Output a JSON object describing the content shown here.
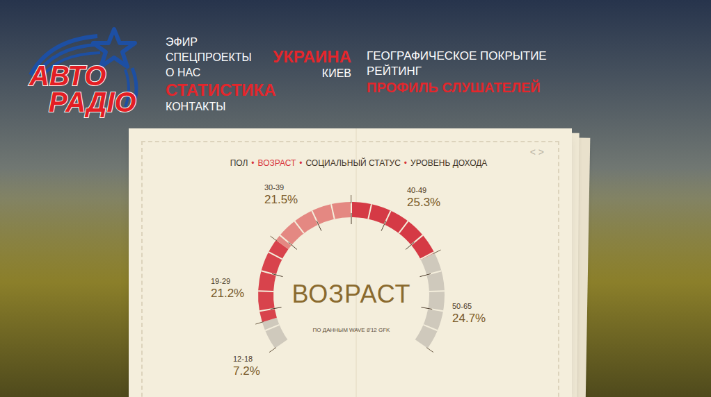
{
  "logo": {
    "line1": "АВТО",
    "line2": "РАДІО"
  },
  "nav": {
    "items": [
      {
        "label": "ЭФИР",
        "selected": false
      },
      {
        "label": "СПЕЦПРОЕКТЫ",
        "selected": false
      },
      {
        "label": "О НАС",
        "selected": false
      },
      {
        "label": "СТАТИСТИКА",
        "selected": true
      },
      {
        "label": "КОНТАКТЫ",
        "selected": false
      }
    ]
  },
  "region": {
    "items": [
      {
        "label": "УКРАИНА",
        "selected": true
      },
      {
        "label": "КИЕВ",
        "selected": false
      }
    ]
  },
  "submenu": {
    "items": [
      {
        "label": "ГЕОГРАФИЧЕСКОЕ ПОКРЫТИЕ",
        "selected": false
      },
      {
        "label": "РЕЙТИНГ",
        "selected": false
      },
      {
        "label": "ПРОФИЛЬ СЛУШАТЕЛЕЙ",
        "selected": true
      }
    ]
  },
  "panel": {
    "tabs": [
      {
        "label": "ПОЛ",
        "selected": false
      },
      {
        "label": "ВОЗРАСТ",
        "selected": true
      },
      {
        "label": "СОЦИАЛЬНЫЙ СТАТУС",
        "selected": false
      },
      {
        "label": "УРОВЕНЬ ДОХОДА",
        "selected": false
      }
    ],
    "separator": "•",
    "arrows": [
      "<",
      ">"
    ],
    "gauge": {
      "title": "ВОЗРАСТ",
      "source": "ПО ДАННЫМ WAVE 8'12 GFK",
      "segments": [
        {
          "label": "12-18",
          "value": "7.2%",
          "level": 0.072,
          "color": "#cfc9bc"
        },
        {
          "label": "19-29",
          "value": "21.2%",
          "level": 0.212,
          "color": "#d8434c"
        },
        {
          "label": "30-39",
          "value": "21.5%",
          "level": 0.215,
          "color": "#e48882"
        },
        {
          "label": "40-49",
          "value": "25.3%",
          "level": 0.253,
          "color": "#d53a45"
        },
        {
          "label": "50-65",
          "value": "24.7%",
          "level": 0.247,
          "color": "#cfc9bc"
        }
      ]
    }
  }
}
